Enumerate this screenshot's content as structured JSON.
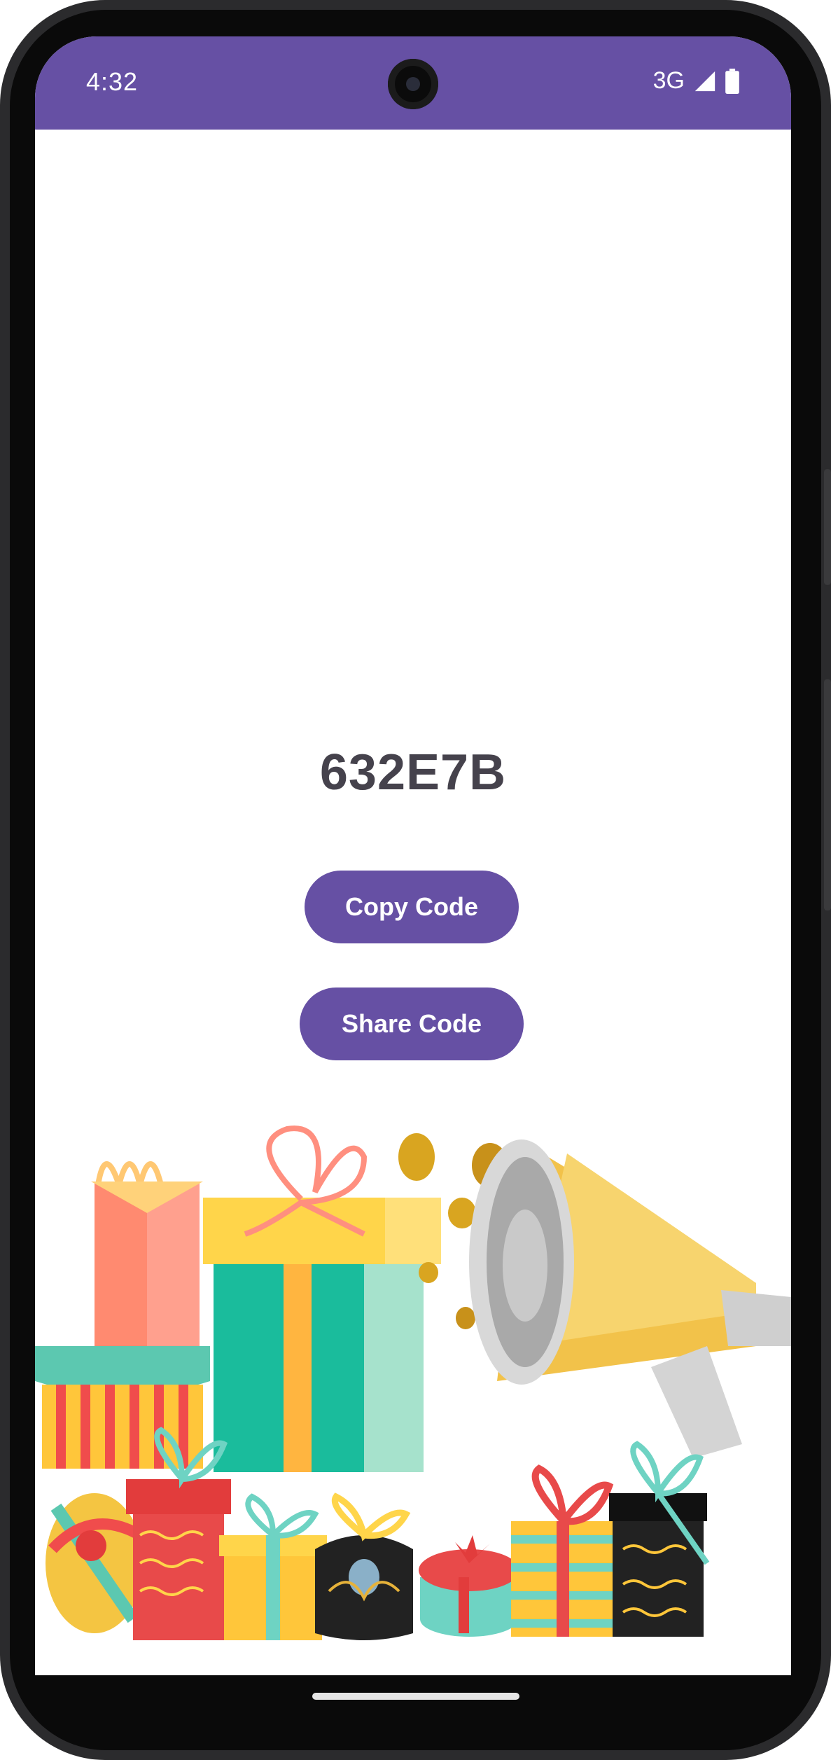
{
  "status_bar": {
    "time": "4:32",
    "network": "3G",
    "color": "#6650a4"
  },
  "main": {
    "code": "632E7B",
    "copy_label": "Copy Code",
    "share_label": "Share Code",
    "accent": "#6650a4"
  },
  "illustration": {
    "name": "gift-boxes-megaphone-illustration"
  }
}
